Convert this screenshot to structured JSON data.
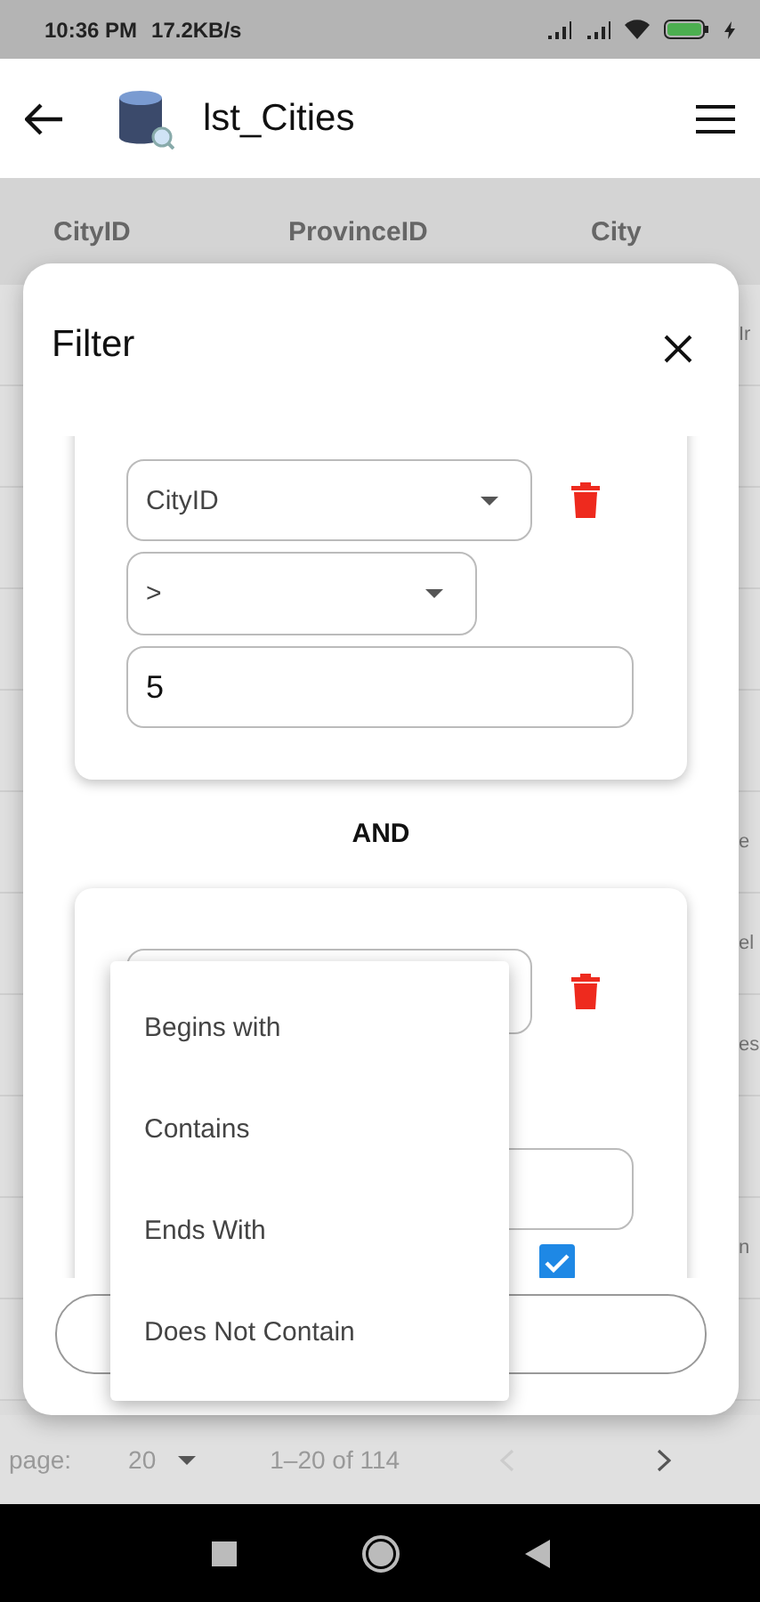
{
  "status_bar": {
    "time": "10:36 PM",
    "speed": "17.2KB/s",
    "battery_charging": true
  },
  "app_bar": {
    "title": "lst_Cities"
  },
  "table": {
    "columns": [
      "CityID",
      "ProvinceID",
      "City"
    ],
    "rows": [
      {
        "column_4": "Ir"
      },
      {},
      {},
      {},
      {},
      {
        "column_4": "e"
      },
      {
        "column_4": "el"
      },
      {
        "column_4": "es"
      },
      {},
      {
        "column_4": "n"
      },
      {}
    ]
  },
  "pagination": {
    "label": "page:",
    "rows_per_page": "20",
    "range": "1–20 of 114",
    "prev_disabled": true,
    "next_disabled": false
  },
  "filter_dialog": {
    "title": "Filter",
    "conditions": [
      {
        "field": "CityID",
        "operator": ">",
        "value": "5"
      },
      {
        "checked": true
      }
    ],
    "connector": "AND",
    "menu": {
      "items": [
        "Begins with",
        "Contains",
        "Ends With",
        "Does Not Contain"
      ]
    }
  }
}
